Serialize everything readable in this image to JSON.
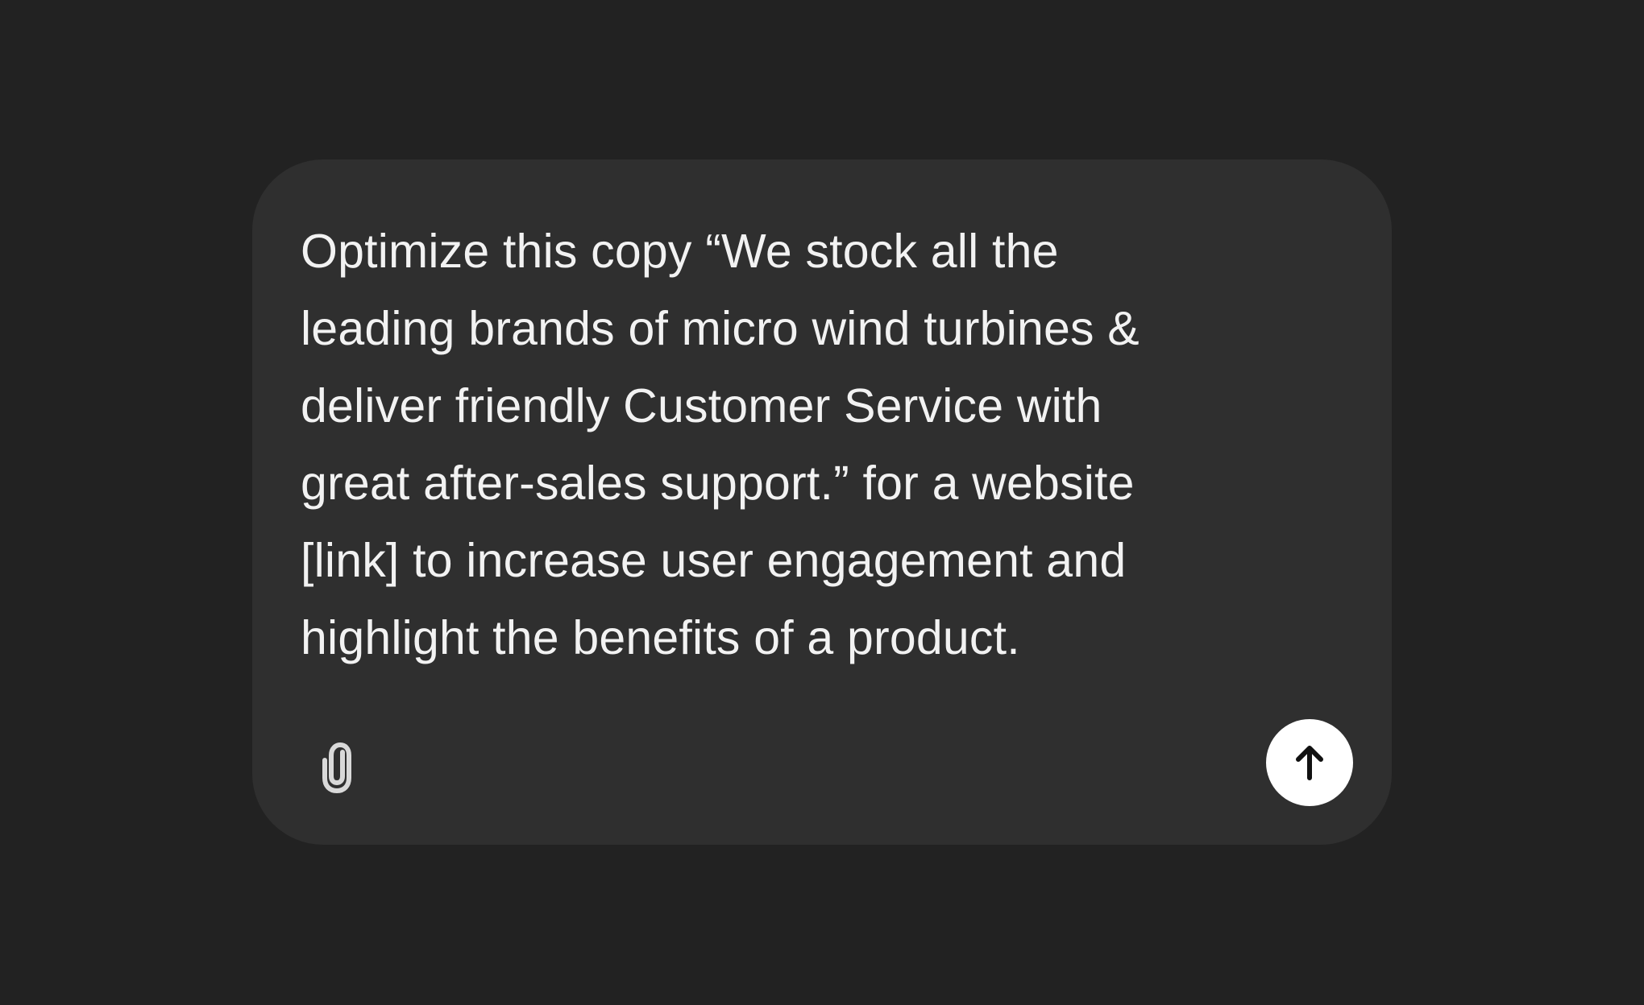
{
  "composer": {
    "prompt_lines": [
      "Optimize this copy “We stock all the",
      "leading brands of micro wind turbines &",
      "deliver friendly Customer Service with",
      "great after-sales support.” for a website",
      "[link] to increase user engagement and",
      "highlight the benefits of a product."
    ],
    "attach_icon": "paperclip-icon",
    "send_icon": "arrow-up-icon"
  },
  "colors": {
    "background": "#222222",
    "composer_background": "#2f2f2f",
    "text": "#f2f2f2",
    "icon": "#d9d9d9",
    "send_button": "#ffffff",
    "send_arrow": "#111111"
  }
}
